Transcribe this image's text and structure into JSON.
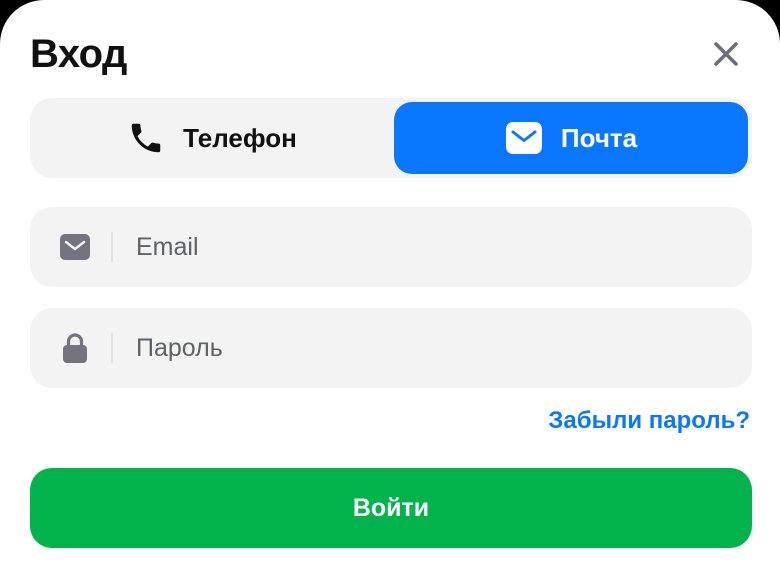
{
  "dialog": {
    "title": "Вход",
    "close_icon": "close-icon"
  },
  "tabs": [
    {
      "label": "Телефон",
      "icon": "phone-icon",
      "selected": false
    },
    {
      "label": "Почта",
      "icon": "mail-icon",
      "selected": true
    }
  ],
  "form": {
    "email": {
      "placeholder": "Email",
      "value": "",
      "icon": "mail-icon"
    },
    "password": {
      "placeholder": "Пароль",
      "value": "",
      "icon": "lock-icon"
    },
    "forgot_label": "Забыли пароль?",
    "submit_label": "Войти"
  },
  "colors": {
    "accent_blue": "#0a77ff",
    "submit_green": "#02b24b",
    "field_bg": "#f3f3f4",
    "icon_gray": "#72757e"
  }
}
